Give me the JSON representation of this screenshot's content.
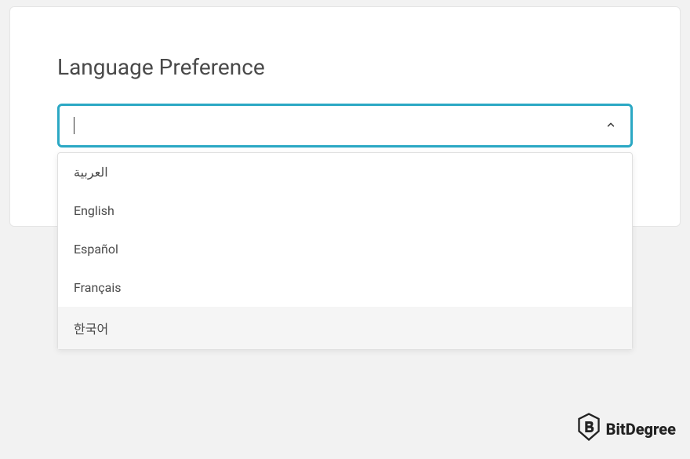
{
  "heading": "Language Preference",
  "dropdown": {
    "value": "",
    "options": [
      {
        "label": "العربية",
        "highlighted": false
      },
      {
        "label": "English",
        "highlighted": false
      },
      {
        "label": "Español",
        "highlighted": false
      },
      {
        "label": "Français",
        "highlighted": false
      },
      {
        "label": "한국어",
        "highlighted": true
      }
    ]
  },
  "watermark": "BitDegree"
}
